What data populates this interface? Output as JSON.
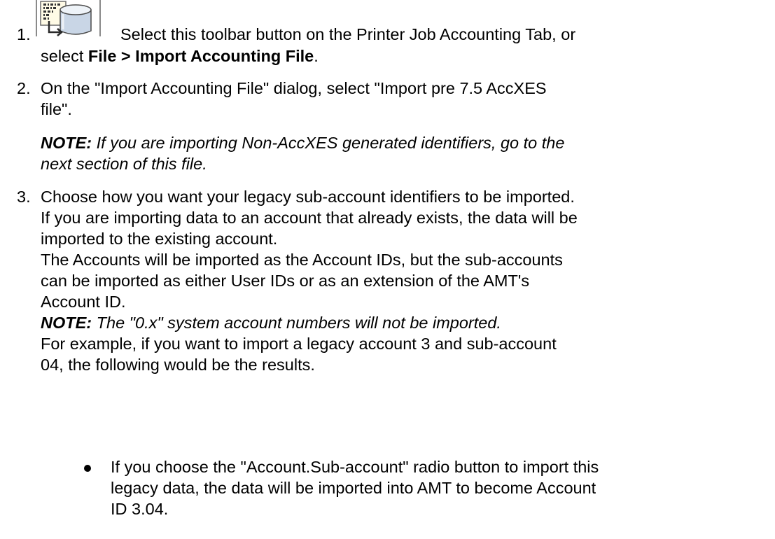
{
  "steps": [
    {
      "number": "1.",
      "text_before": "Select this toolbar button on the Printer Job Accounting Tab, or",
      "text_line2_prefix": "select ",
      "menu_path": "File > Import Accounting File",
      "text_line2_suffix": ".",
      "icon": "import-accounting-file-icon"
    },
    {
      "number": "2.",
      "line1": "On the \"Import Accounting File\" dialog, select \"Import pre 7.5 AccXES",
      "line2": "file\".",
      "note_label": "NOTE:",
      "note_line1": " If you are importing Non-AccXES generated identifiers, go to the",
      "note_line2": "next section of this file."
    },
    {
      "number": "3.",
      "lines": [
        "Choose how you want your legacy sub-account identifiers to be imported.",
        "If you are importing data to an account that already exists, the data will be",
        "imported to the existing account.",
        "The Accounts will be imported as the Account IDs, but the sub-accounts",
        "can be imported as either User IDs or as an extension of the AMT's",
        "Account ID."
      ],
      "note_label": "NOTE:",
      "note_text": " The \"0.x\" system account numbers will not be imported.",
      "example_lines": [
        "For example, if you want to import a legacy account 3 and sub-account",
        "04, the following would be the results."
      ],
      "bullets": [
        {
          "lines": [
            "If you choose the \"Account.Sub-account\" radio button to import this",
            "legacy data, the data will be imported into AMT to become Account",
            "ID 3.04."
          ]
        }
      ]
    }
  ]
}
